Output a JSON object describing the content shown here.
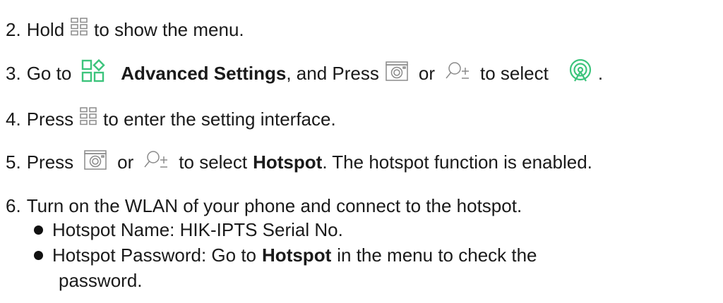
{
  "steps": [
    {
      "num": "2.",
      "pre": "Hold",
      "post": "to show the menu."
    },
    {
      "num": "3.",
      "pre": "Go to",
      "bold": "Advanced Settings",
      "mid": ", and Press",
      "or": "or",
      "post": "to select",
      "end": "."
    },
    {
      "num": "4.",
      "pre": "Press",
      "post": "to enter the setting interface."
    },
    {
      "num": "5.",
      "pre": "Press",
      "or": "or",
      "mid": "to select",
      "bold": "Hotspot",
      "post": ". The hotspot function is enabled."
    },
    {
      "num": "6.",
      "text": "Turn on the WLAN of your phone and connect to the hotspot."
    }
  ],
  "bullets": [
    {
      "text": "Hotspot Name: HIK-IPTS Serial No."
    },
    {
      "pre": "Hotspot Password: Go to",
      "bold": "Hotspot",
      "post": "in the menu to check the",
      "cont": "password."
    }
  ],
  "colors": {
    "text": "#1a1a1a",
    "icon_gray": "#8a8a8a",
    "icon_green": "#3cc47c"
  },
  "icons": {
    "menu": "menu-grid-icon",
    "advanced": "advanced-settings-icon",
    "camera": "camera-icon",
    "zoom": "zoom-icon",
    "hotspot": "hotspot-icon"
  }
}
